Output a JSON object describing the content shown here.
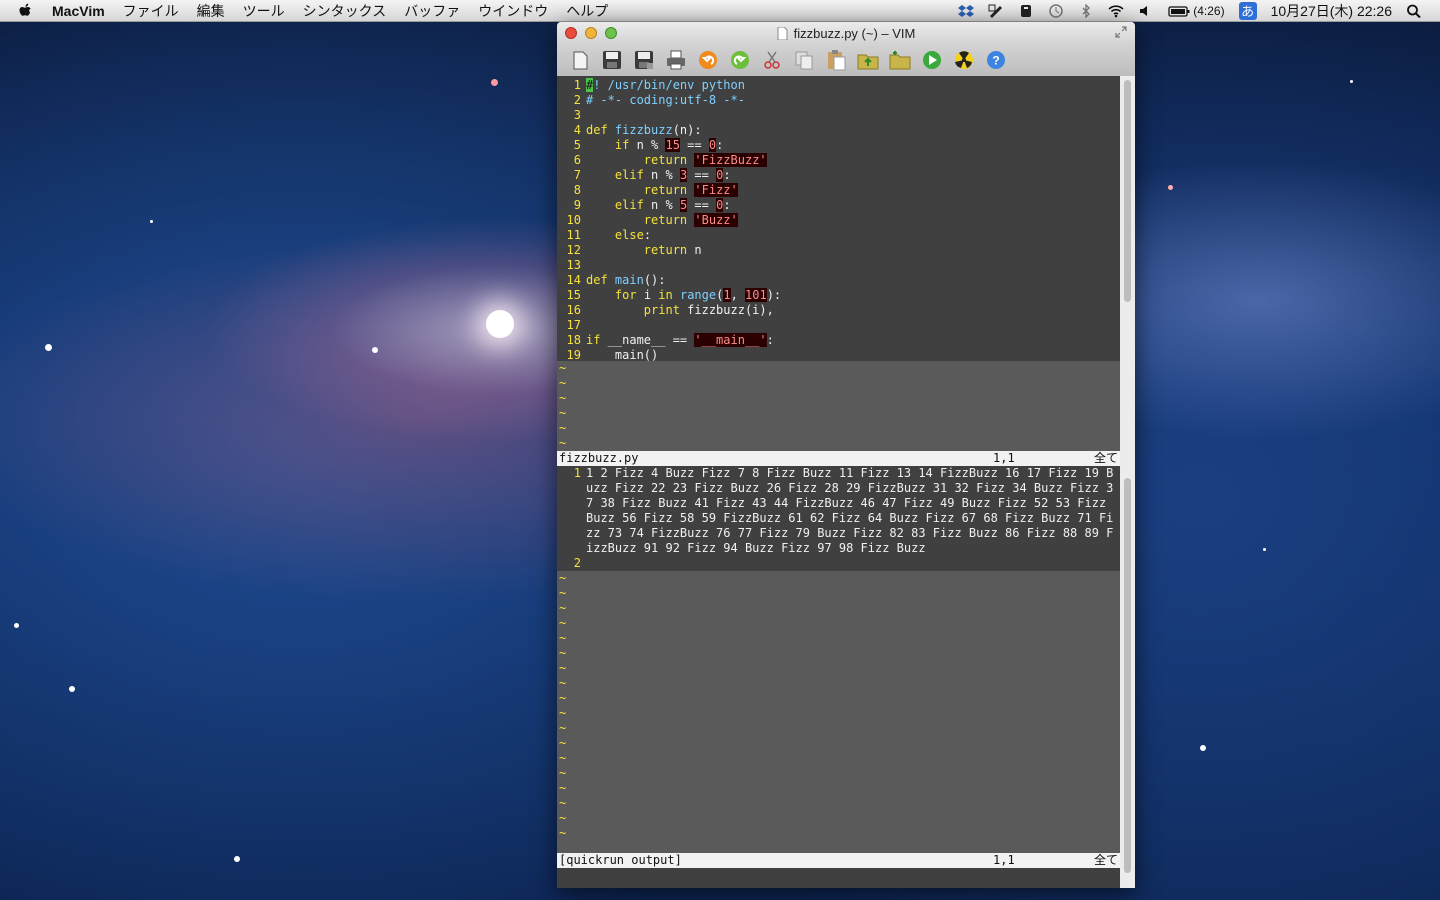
{
  "menubar": {
    "app_name": "MacVim",
    "items": [
      "ファイル",
      "編集",
      "ツール",
      "シンタックス",
      "バッファ",
      "ウインドウ",
      "ヘルプ"
    ],
    "battery_time": "(4:26)",
    "ime": "あ",
    "datetime": "10月27日(木) 22:26"
  },
  "window": {
    "title": "fizzbuzz.py (~) – VIM"
  },
  "toolbar": {
    "icons": [
      "open-icon",
      "save-icon",
      "save-all-icon",
      "print-icon",
      "undo-icon",
      "redo-icon",
      "cut-icon",
      "copy-icon",
      "paste-icon",
      "load-session-icon",
      "save-session-icon",
      "run-icon",
      "make-icon",
      "help-icon"
    ]
  },
  "editor": {
    "lines": [
      {
        "n": "1",
        "tokens": [
          {
            "c": "cursor",
            "t": "#"
          },
          {
            "c": "cm",
            "t": "! /usr/bin/env python"
          }
        ]
      },
      {
        "n": "2",
        "tokens": [
          {
            "c": "cm",
            "t": "# -*- coding:utf-8 -*-"
          }
        ]
      },
      {
        "n": "3",
        "tokens": []
      },
      {
        "n": "4",
        "tokens": [
          {
            "c": "kw",
            "t": "def "
          },
          {
            "c": "fn",
            "t": "fizzbuzz"
          },
          {
            "c": "",
            "t": "(n):"
          }
        ]
      },
      {
        "n": "5",
        "tokens": [
          {
            "c": "",
            "t": "    "
          },
          {
            "c": "kw",
            "t": "if"
          },
          {
            "c": "",
            "t": " n % "
          },
          {
            "c": "num",
            "t": "15"
          },
          {
            "c": "",
            "t": " == "
          },
          {
            "c": "num",
            "t": "0"
          },
          {
            "c": "",
            "t": ":"
          }
        ]
      },
      {
        "n": "6",
        "tokens": [
          {
            "c": "",
            "t": "        "
          },
          {
            "c": "kw",
            "t": "return"
          },
          {
            "c": "",
            "t": " "
          },
          {
            "c": "str",
            "t": "'FizzBuzz'"
          }
        ]
      },
      {
        "n": "7",
        "tokens": [
          {
            "c": "",
            "t": "    "
          },
          {
            "c": "kw",
            "t": "elif"
          },
          {
            "c": "",
            "t": " n % "
          },
          {
            "c": "num",
            "t": "3"
          },
          {
            "c": "",
            "t": " == "
          },
          {
            "c": "num",
            "t": "0"
          },
          {
            "c": "",
            "t": ":"
          }
        ]
      },
      {
        "n": "8",
        "tokens": [
          {
            "c": "",
            "t": "        "
          },
          {
            "c": "kw",
            "t": "return"
          },
          {
            "c": "",
            "t": " "
          },
          {
            "c": "str",
            "t": "'Fizz'"
          }
        ]
      },
      {
        "n": "9",
        "tokens": [
          {
            "c": "",
            "t": "    "
          },
          {
            "c": "kw",
            "t": "elif"
          },
          {
            "c": "",
            "t": " n % "
          },
          {
            "c": "num",
            "t": "5"
          },
          {
            "c": "",
            "t": " == "
          },
          {
            "c": "num",
            "t": "0"
          },
          {
            "c": "",
            "t": ":"
          }
        ]
      },
      {
        "n": "10",
        "tokens": [
          {
            "c": "",
            "t": "        "
          },
          {
            "c": "kw",
            "t": "return"
          },
          {
            "c": "",
            "t": " "
          },
          {
            "c": "str",
            "t": "'Buzz'"
          }
        ]
      },
      {
        "n": "11",
        "tokens": [
          {
            "c": "",
            "t": "    "
          },
          {
            "c": "kw",
            "t": "else"
          },
          {
            "c": "",
            "t": ":"
          }
        ]
      },
      {
        "n": "12",
        "tokens": [
          {
            "c": "",
            "t": "        "
          },
          {
            "c": "kw",
            "t": "return"
          },
          {
            "c": "",
            "t": " n"
          }
        ]
      },
      {
        "n": "13",
        "tokens": []
      },
      {
        "n": "14",
        "tokens": [
          {
            "c": "kw",
            "t": "def "
          },
          {
            "c": "fn",
            "t": "main"
          },
          {
            "c": "",
            "t": "():"
          }
        ]
      },
      {
        "n": "15",
        "tokens": [
          {
            "c": "",
            "t": "    "
          },
          {
            "c": "kw",
            "t": "for"
          },
          {
            "c": "",
            "t": " i "
          },
          {
            "c": "kw",
            "t": "in"
          },
          {
            "c": "",
            "t": " "
          },
          {
            "c": "fn",
            "t": "range"
          },
          {
            "c": "",
            "t": "("
          },
          {
            "c": "num",
            "t": "1"
          },
          {
            "c": "",
            "t": ", "
          },
          {
            "c": "num",
            "t": "101"
          },
          {
            "c": "",
            "t": "):"
          }
        ]
      },
      {
        "n": "16",
        "tokens": [
          {
            "c": "",
            "t": "        "
          },
          {
            "c": "kw",
            "t": "print"
          },
          {
            "c": "",
            "t": " fizzbuzz(i),"
          }
        ]
      },
      {
        "n": "17",
        "tokens": []
      },
      {
        "n": "18",
        "tokens": [
          {
            "c": "kw",
            "t": "if"
          },
          {
            "c": "",
            "t": " __name__ == "
          },
          {
            "c": "str",
            "t": "'__main__'"
          },
          {
            "c": "",
            "t": ":"
          }
        ]
      },
      {
        "n": "19",
        "tokens": [
          {
            "c": "",
            "t": "    main()"
          }
        ]
      }
    ],
    "tilde_count_top": 6,
    "status_top": {
      "file": "fizzbuzz.py",
      "pos": "1,1",
      "all": "全て"
    },
    "output": {
      "line1_num": "1",
      "line1_text": "1 2 Fizz 4 Buzz Fizz 7 8 Fizz Buzz 11 Fizz 13 14 FizzBuzz 16 17 Fizz 19 Buzz Fizz 22 23 Fizz Buzz 26 Fizz 28 29 FizzBuzz 31 32 Fizz 34 Buzz Fizz 37 38 Fizz Buzz 41 Fizz 43 44 FizzBuzz 46 47 Fizz 49 Buzz Fizz 52 53 Fizz Buzz 56 Fizz 58 59 FizzBuzz 61 62 Fizz 64 Buzz Fizz 67 68 Fizz Buzz 71 Fizz 73 74 FizzBuzz 76 77 Fizz 79 Buzz Fizz 82 83 Fizz Buzz 86 Fizz 88 89 FizzBuzz 91 92 Fizz 94 Buzz Fizz 97 98 Fizz Buzz",
      "line2_num": "2"
    },
    "tilde_count_bottom": 18,
    "status_bottom": {
      "file": "[quickrun output]",
      "pos": "1,1",
      "all": "全て"
    }
  },
  "colors": {
    "keyword": "#f5e23c",
    "comment": "#7fd0ff",
    "string": "#ff8a8a",
    "linenr": "#f5e23c"
  }
}
